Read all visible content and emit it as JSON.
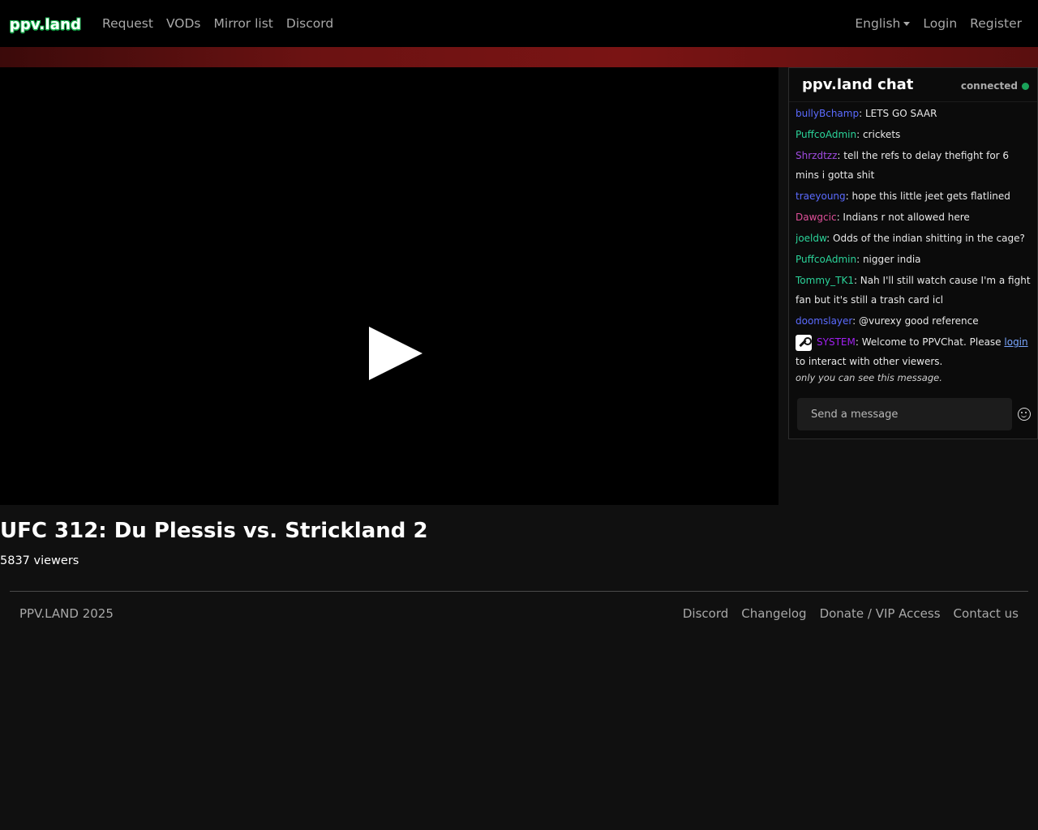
{
  "nav": {
    "logo": "ppv.land",
    "links": [
      "Request",
      "VODs",
      "Mirror list",
      "Discord"
    ],
    "language": "English",
    "login": "Login",
    "register": "Register"
  },
  "chat": {
    "title": "ppv.land chat",
    "status": "connected",
    "messages": [
      {
        "user": "bullyBchamp",
        "color": "#5b6bff",
        "text": ": LETS GO SAAR"
      },
      {
        "user": "PuffcoAdmin",
        "color": "#2bd49a",
        "text": ": crickets"
      },
      {
        "user": "Shrzdtzz",
        "color": "#a04be0",
        "text": ": tell the refs to delay thefight for 6 mins i gotta shit"
      },
      {
        "user": "traeyoung",
        "color": "#5b6bff",
        "text": ": hope this little jeet gets flatlined"
      },
      {
        "user": "Dawgcic",
        "color": "#e0509a",
        "text": ": Indians r not allowed here"
      },
      {
        "user": "joeldw",
        "color": "#2bd49a",
        "text": ": Odds of the indian shitting in the cage?"
      },
      {
        "user": "PuffcoAdmin",
        "color": "#2bd49a",
        "text": ": nigger india"
      },
      {
        "user": "Tommy_TK1",
        "color": "#2bd49a",
        "text": ": Nah I'll still watch cause I'm a fight fan but it's still a trash card icl"
      },
      {
        "user": "doomslayer",
        "color": "#5b6bff",
        "text": ": @vurexy good reference"
      }
    ],
    "system": {
      "user": "SYSTEM",
      "color": "#a020f0",
      "text_before": ": Welcome to PPVChat. Please ",
      "link": "login",
      "text_after": " to interact with other viewers.",
      "note": "only you can see this message."
    },
    "input_placeholder": "Send a message"
  },
  "stream": {
    "title": "UFC 312: Du Plessis vs. Strickland 2",
    "viewers": "5837 viewers"
  },
  "footer": {
    "copyright": "PPV.LAND 2025",
    "links": [
      "Discord",
      "Changelog",
      "Donate / VIP Access",
      "Contact us"
    ]
  },
  "colors": {
    "banner": "#6b1212",
    "status_dot": "#1aa25a",
    "logo_outline": "#1db954"
  }
}
